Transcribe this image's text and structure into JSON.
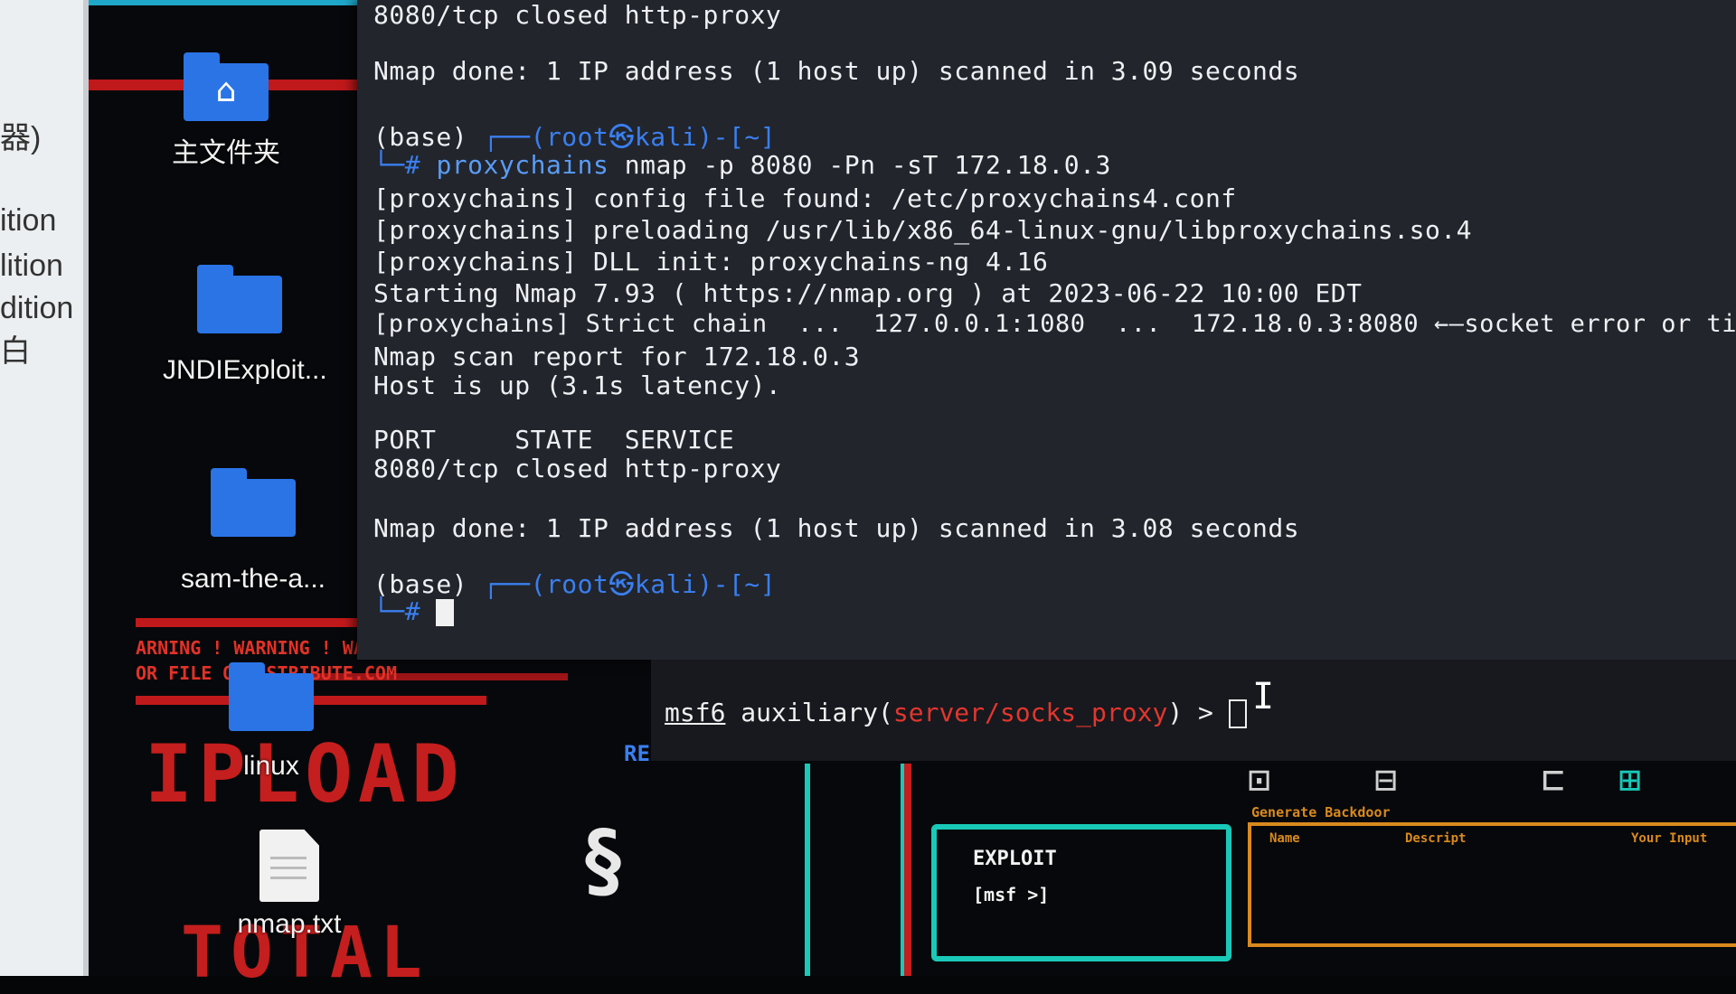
{
  "left_window": {
    "items": [
      "器)",
      "ition",
      "lition",
      "dition 白"
    ]
  },
  "desktop": {
    "icons": [
      {
        "label": "主文件夹",
        "icon": "home-folder-icon"
      },
      {
        "label": "JNDIExploit...",
        "icon": "folder-icon"
      },
      {
        "label": "sam-the-a...",
        "icon": "folder-icon"
      },
      {
        "label": "linux",
        "icon": "folder-icon"
      },
      {
        "label": "nmap.txt",
        "icon": "text-file-icon"
      }
    ],
    "warning_line1": "ARNING ! WARNING ! WARNIN",
    "warning_line2": "OR FILE   ODDISTRIBUTE.COM",
    "upload_art": "IPLOAD",
    "total_art": "TOTAL"
  },
  "terminal": {
    "lines": {
      "l0": "8080/tcp closed http-proxy",
      "l1": "Nmap done: 1 IP address (1 host up) scanned in 3.09 seconds",
      "prompt1_base": "(base) ",
      "prompt1_user": "┌──(root㉿kali)-[~]",
      "prompt1_hash": "└─# ",
      "cmd_proxy": "proxychains",
      "cmd_rest": " nmap -p 8080 -Pn -sT 172.18.0.3",
      "l4": "[proxychains] config file found: /etc/proxychains4.conf",
      "l5": "[proxychains] preloading /usr/lib/x86_64-linux-gnu/libproxychains.so.4",
      "l6": "[proxychains] DLL init: proxychains-ng 4.16",
      "l7": "Starting Nmap 7.93 ( https://nmap.org ) at 2023-06-22 10:00 EDT",
      "l8": "[proxychains] Strict chain  ...  127.0.0.1:1080  ...  172.18.0.3:8080 ←—socket error or timeou",
      "l9": "Nmap scan report for 172.18.0.3",
      "l10": "Host is up (3.1s latency).",
      "l11": "PORT     STATE  SERVICE",
      "l12": "8080/tcp closed http-proxy",
      "l13": "Nmap done: 1 IP address (1 host up) scanned in 3.08 seconds",
      "prompt2_base": "(base) ",
      "prompt2_user": "┌──(root㉿kali)-[~]",
      "prompt2_hash": "└─# "
    }
  },
  "msf": {
    "prefix": "msf6",
    "mid": " auxiliary(",
    "module": "server/socks_proxy",
    "suffix": ") > "
  },
  "bottom_art": {
    "exploit_title": "EXPLOIT",
    "msf_label": "[msf >]",
    "backdoor_header": "Generate Backdoor",
    "col1": "Name",
    "col2": "Descript",
    "col3": "Your Input",
    "re_label": "RE"
  }
}
